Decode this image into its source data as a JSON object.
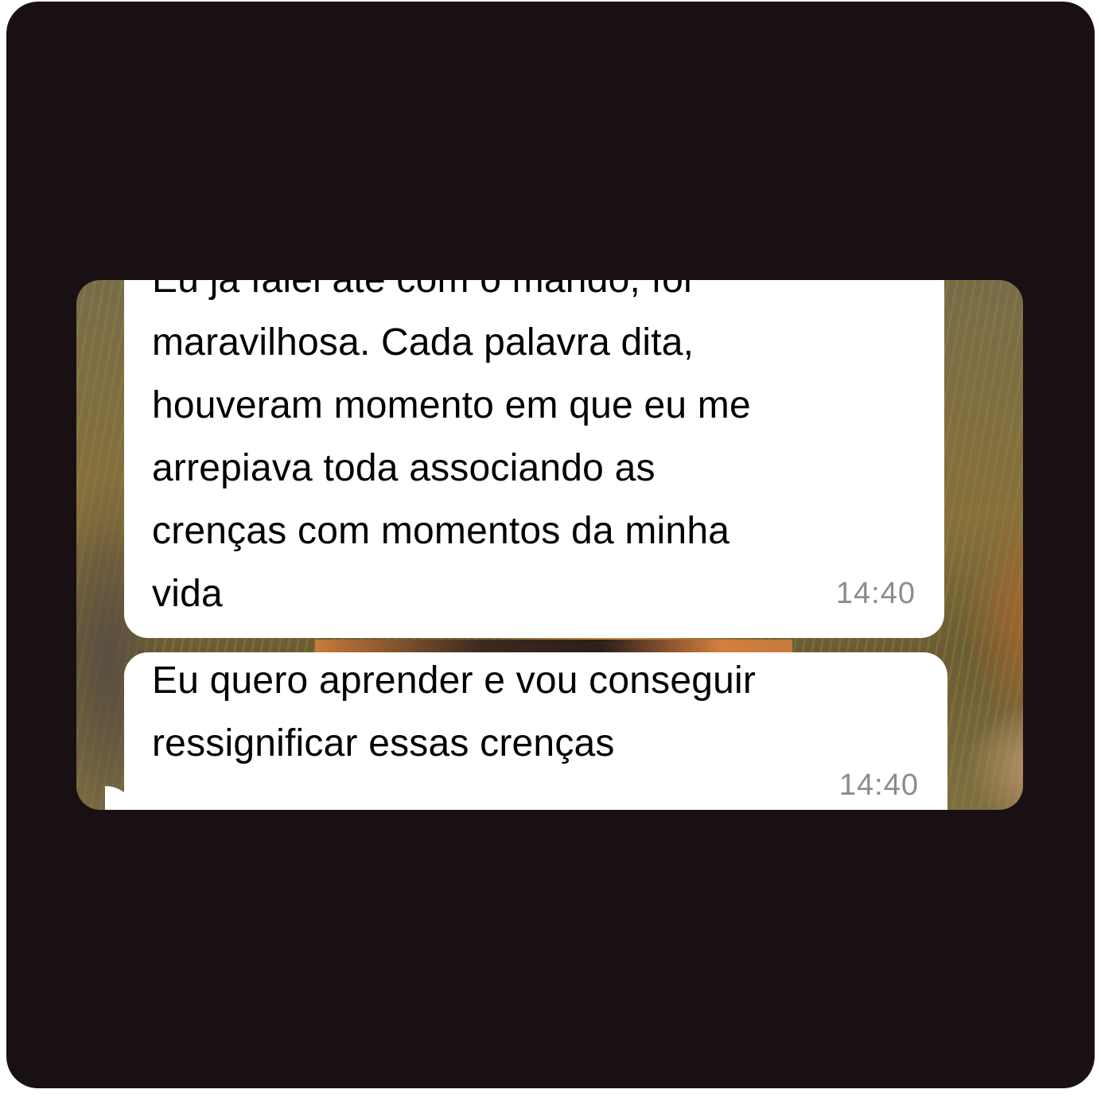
{
  "messages": [
    {
      "lines": [
        "Eu já falei até com o marido, foi",
        "maravilhosa. Cada palavra dita,",
        "houveram momento em que eu me",
        "arrepiava toda associando as",
        "crenças com momentos da minha",
        "vida"
      ],
      "time": "14:40"
    },
    {
      "lines": [
        "Eu quero aprender e vou conseguir",
        "ressignificar essas crenças"
      ],
      "time": "14:40"
    }
  ],
  "colors": {
    "page_bg": "#181013",
    "bubble_bg": "#ffffff",
    "timestamp": "#8c8c8c"
  }
}
